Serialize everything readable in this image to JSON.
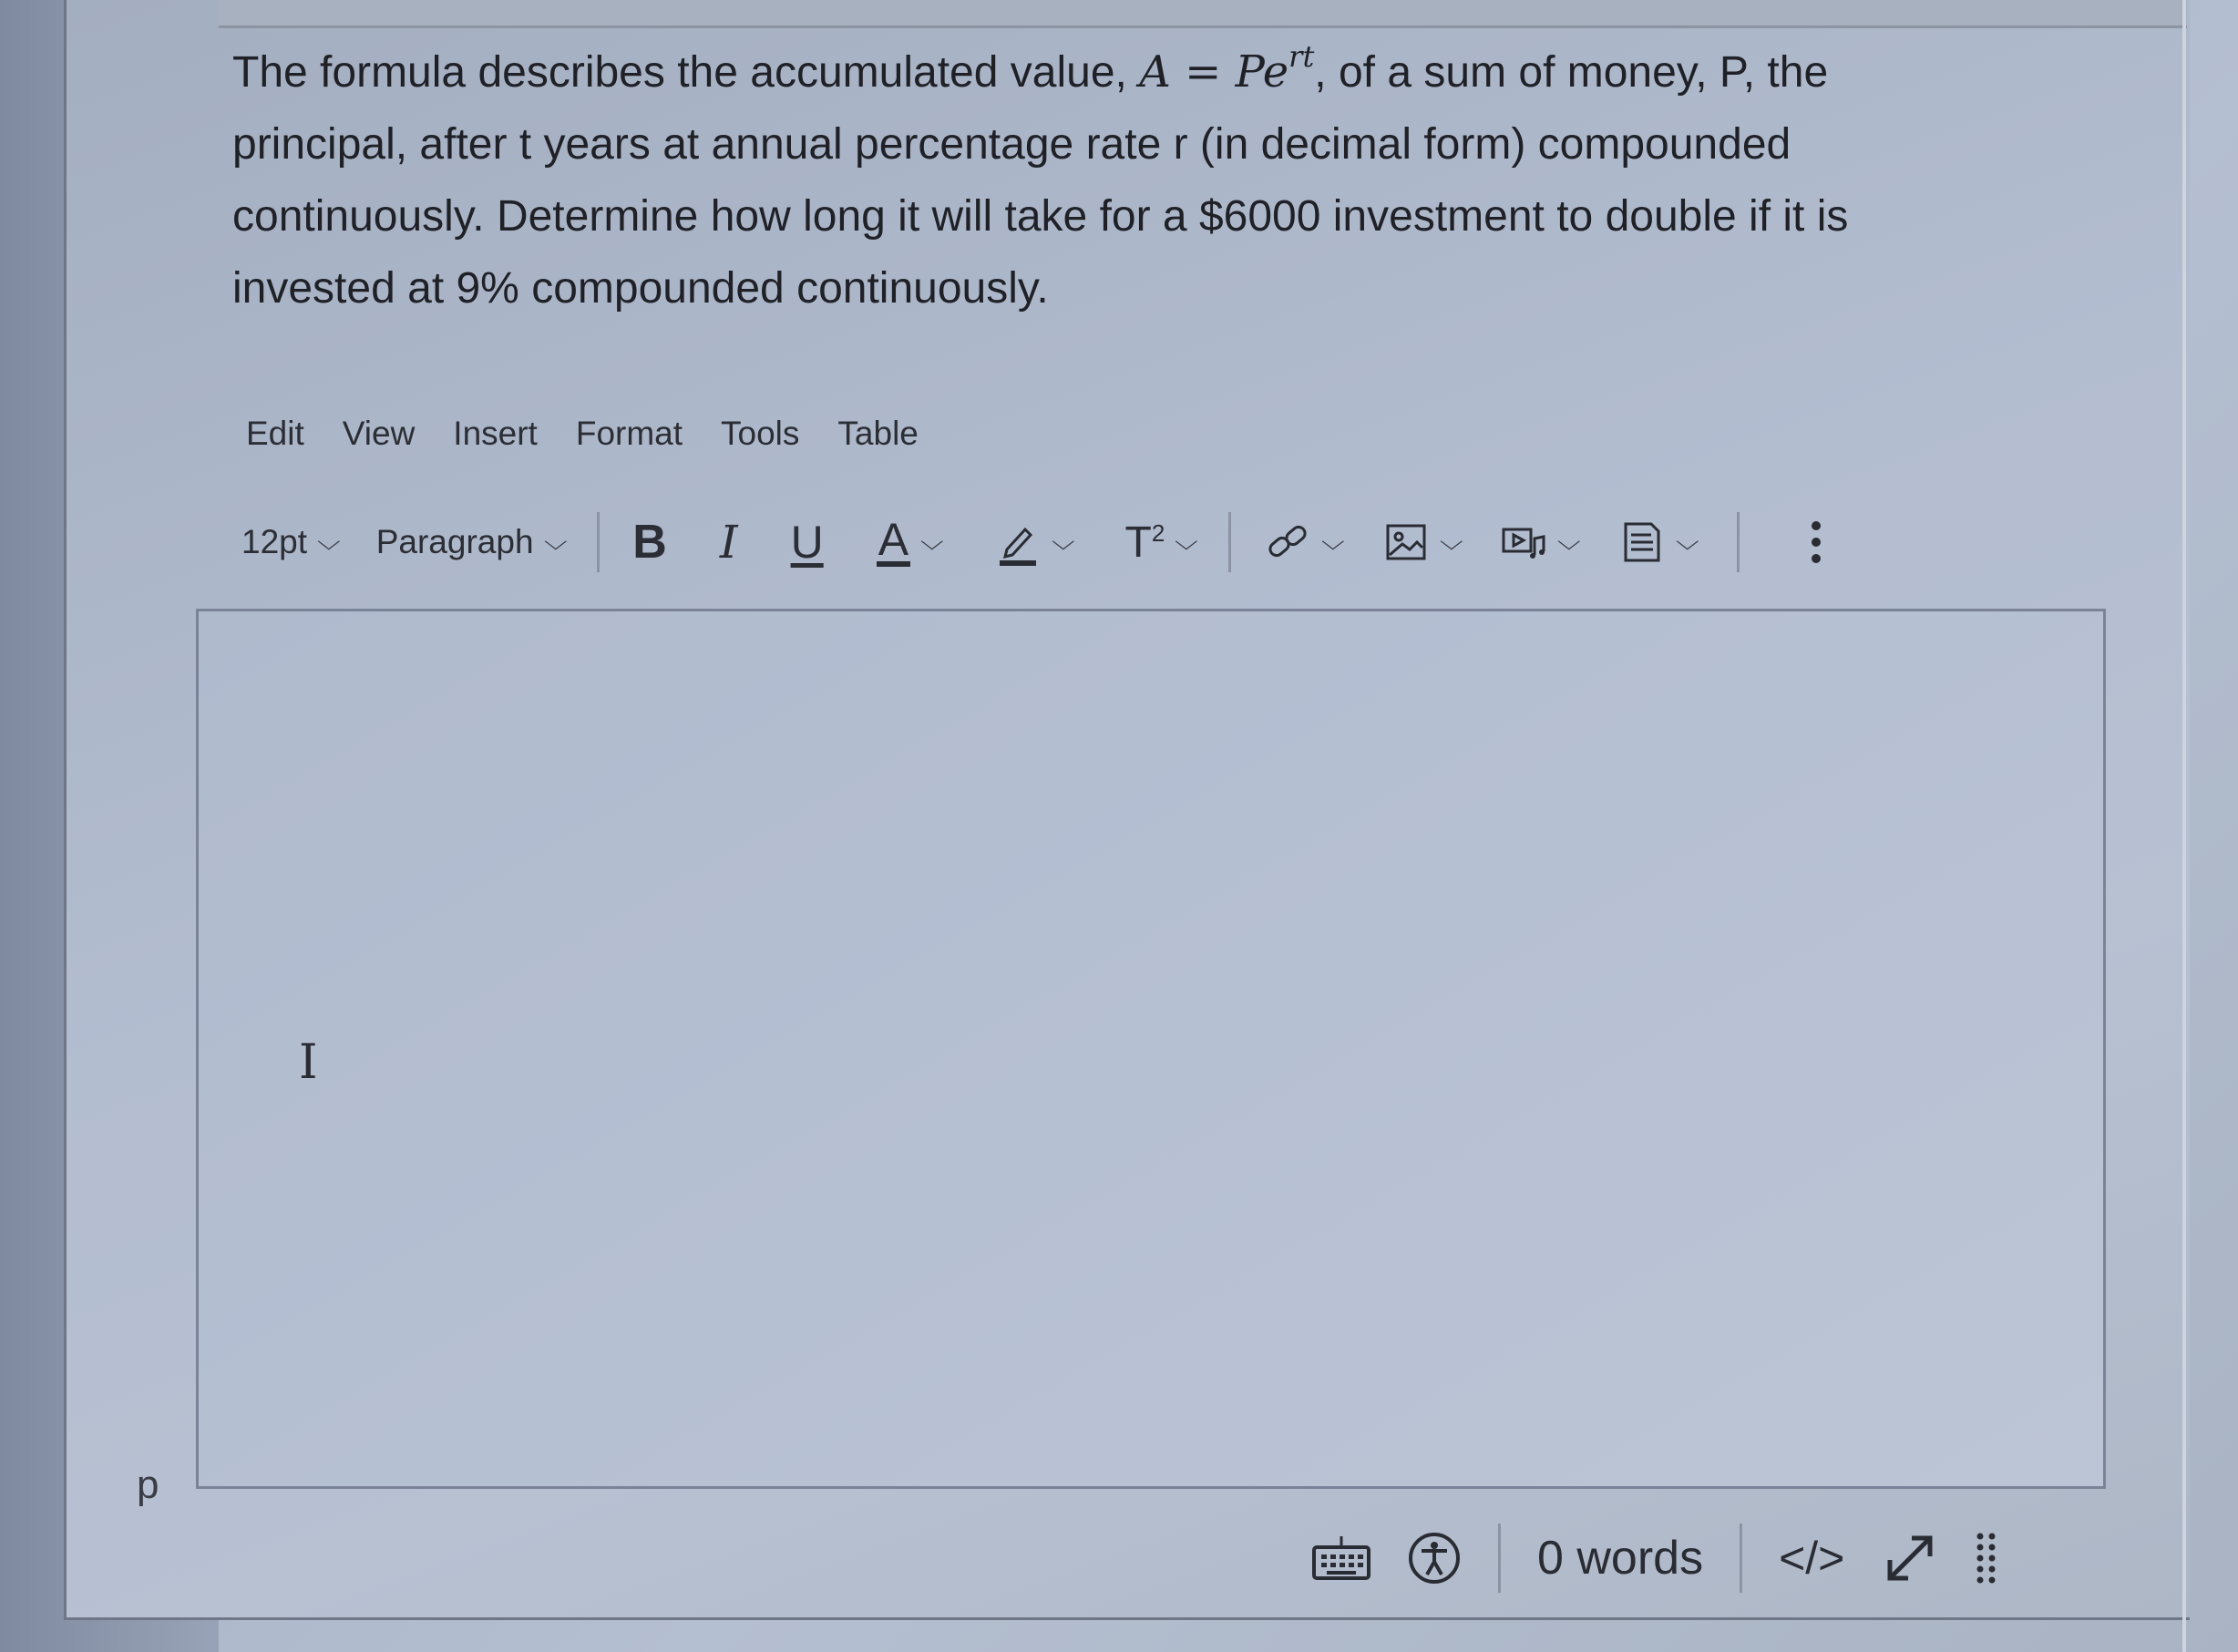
{
  "question": {
    "intro": "The formula describes the accumulated value,",
    "formula_base": "A = Pe",
    "formula_exp": "rt",
    "rest": ", of a sum of money, P, the principal, after t years at annual percentage rate r (in decimal form) compounded continuously. Determine how long it will take for a $6000 investment to double if it is invested at 9% compounded continuously."
  },
  "menu": [
    "Edit",
    "View",
    "Insert",
    "Format",
    "Tools",
    "Table"
  ],
  "toolbar": {
    "font_size": "12pt",
    "block_format": "Paragraph",
    "bold": "B",
    "italic": "I",
    "underline": "U",
    "text_color": "A",
    "superscript_base": "T",
    "superscript_exp": "2",
    "icons": [
      "pencil-icon",
      "link-icon",
      "image-icon",
      "media-icon",
      "document-icon",
      "more-vertical-icon"
    ]
  },
  "editor": {
    "cursor": "I",
    "path": "p"
  },
  "status": {
    "word_count": "0 words",
    "html_toggle": "</>",
    "icons": [
      "keyboard-icon",
      "accessibility-icon",
      "fullscreen-icon",
      "resize-handle-icon"
    ]
  }
}
